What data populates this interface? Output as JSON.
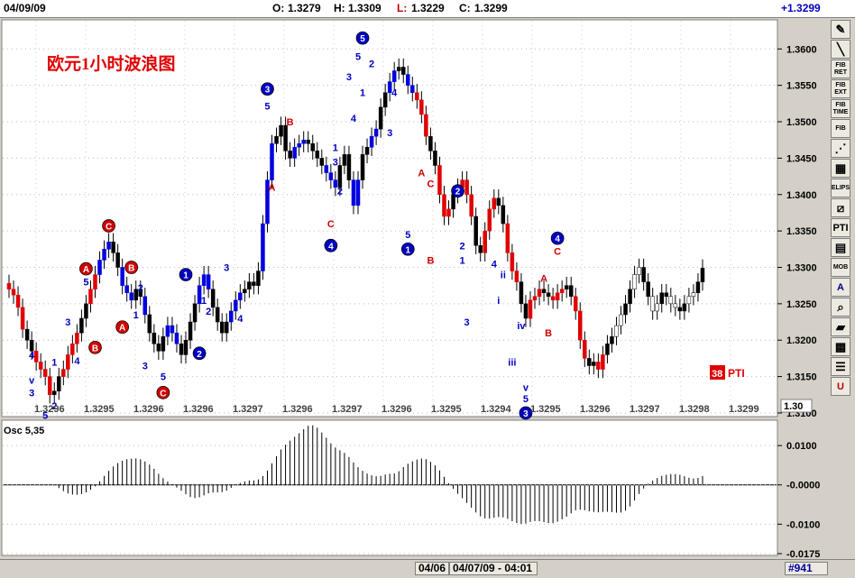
{
  "header": {
    "date": "04/09/09",
    "open_label": "O:",
    "open_value": "1.3279",
    "high_label": "H:",
    "high_value": "1.3309",
    "low_label": "L:",
    "low_value": "1.3229",
    "close_label": "C:",
    "close_value": "1.3299",
    "change": "+1.3299"
  },
  "chart_data": {
    "type": "candlestick",
    "title": "欧元1小时波浪图",
    "price_axis_ticks": [
      "1.3600",
      "1.3550",
      "1.3500",
      "1.3450",
      "1.3400",
      "1.3350",
      "1.3300",
      "1.3250",
      "1.3200",
      "1.3150",
      "1.3100"
    ],
    "price_range": [
      1.3095,
      1.364
    ],
    "current_price_label": "1.30",
    "x_labels": [
      "1.3296",
      "1.3295",
      "1.3296",
      "1.3296",
      "1.3297",
      "1.3296",
      "1.3297",
      "1.3296",
      "1.3295",
      "1.3294",
      "1.3295",
      "1.3296",
      "1.3297",
      "1.3298",
      "1.3299"
    ],
    "closes": [
      1.327,
      1.3262,
      1.3245,
      1.3215,
      1.32,
      1.3185,
      1.317,
      1.316,
      1.315,
      1.3125,
      1.313,
      1.315,
      1.316,
      1.318,
      1.3195,
      1.321,
      1.323,
      1.325,
      1.327,
      1.329,
      1.331,
      1.3325,
      1.3335,
      1.332,
      1.33,
      1.3275,
      1.3265,
      1.3255,
      1.327,
      1.326,
      1.3235,
      1.321,
      1.3195,
      1.3185,
      1.3205,
      1.322,
      1.321,
      1.3195,
      1.318,
      1.32,
      1.3225,
      1.325,
      1.3275,
      1.329,
      1.327,
      1.3245,
      1.3225,
      1.321,
      1.3225,
      1.324,
      1.3255,
      1.3265,
      1.327,
      1.328,
      1.3275,
      1.3295,
      1.336,
      1.342,
      1.347,
      1.348,
      1.3495,
      1.346,
      1.345,
      1.3465,
      1.347,
      1.3475,
      1.347,
      1.346,
      1.345,
      1.344,
      1.343,
      1.342,
      1.341,
      1.344,
      1.3455,
      1.342,
      1.3385,
      1.342,
      1.3455,
      1.3465,
      1.348,
      1.349,
      1.352,
      1.354,
      1.3555,
      1.357,
      1.3575,
      1.3565,
      1.355,
      1.354,
      1.353,
      1.351,
      1.348,
      1.346,
      1.344,
      1.34,
      1.337,
      1.338,
      1.34,
      1.341,
      1.342,
      1.34,
      1.337,
      1.333,
      1.332,
      1.335,
      1.338,
      1.3395,
      1.3385,
      1.336,
      1.332,
      1.3295,
      1.328,
      1.325,
      1.323,
      1.3255,
      1.326,
      1.327,
      1.3265,
      1.326,
      1.3255,
      1.3265,
      1.327,
      1.3275,
      1.326,
      1.324,
      1.32,
      1.3175,
      1.3165,
      1.317,
      1.316,
      1.318,
      1.3195,
      1.3205,
      1.322,
      1.3235,
      1.325,
      1.327,
      1.329,
      1.33,
      1.328,
      1.326,
      1.324,
      1.325,
      1.3265,
      1.326,
      1.325,
      1.3245,
      1.324,
      1.325,
      1.326,
      1.3265,
      1.328,
      1.3299
    ],
    "wave_labels": [
      {
        "text": "4",
        "price": 1.318,
        "bar": 5,
        "color": "blue",
        "style": "plain"
      },
      {
        "text": "v",
        "price": 1.3145,
        "bar": 5,
        "color": "blue",
        "style": "plain"
      },
      {
        "text": "3",
        "price": 1.3128,
        "bar": 5,
        "color": "blue",
        "style": "plain"
      },
      {
        "text": "5",
        "price": 1.3097,
        "bar": 8,
        "color": "blue",
        "style": "plain"
      },
      {
        "text": "2",
        "price": 1.311,
        "bar": 10,
        "color": "blue",
        "style": "plain"
      },
      {
        "text": "1",
        "price": 1.317,
        "bar": 10,
        "color": "blue",
        "style": "plain"
      },
      {
        "text": "3",
        "price": 1.3225,
        "bar": 13,
        "color": "blue",
        "style": "plain"
      },
      {
        "text": "4",
        "price": 1.3172,
        "bar": 15,
        "color": "blue",
        "style": "plain"
      },
      {
        "text": "A",
        "price": 1.3298,
        "bar": 17,
        "color": "red",
        "style": "circle"
      },
      {
        "text": "5",
        "price": 1.328,
        "bar": 17,
        "color": "blue",
        "style": "plain"
      },
      {
        "text": "B",
        "price": 1.319,
        "bar": 19,
        "color": "red",
        "style": "circle"
      },
      {
        "text": "C",
        "price": 1.3357,
        "bar": 22,
        "color": "red",
        "style": "circle"
      },
      {
        "text": "A",
        "price": 1.3218,
        "bar": 25,
        "color": "red",
        "style": "circle"
      },
      {
        "text": "B",
        "price": 1.33,
        "bar": 27,
        "color": "red",
        "style": "circle"
      },
      {
        "text": "2",
        "price": 1.3272,
        "bar": 29,
        "color": "blue",
        "style": "plain"
      },
      {
        "text": "1",
        "price": 1.3235,
        "bar": 28,
        "color": "blue",
        "style": "plain"
      },
      {
        "text": "3",
        "price": 1.3165,
        "bar": 30,
        "color": "blue",
        "style": "plain"
      },
      {
        "text": "5",
        "price": 1.315,
        "bar": 34,
        "color": "blue",
        "style": "plain"
      },
      {
        "text": "C",
        "price": 1.3128,
        "bar": 34,
        "color": "red",
        "style": "circle"
      },
      {
        "text": "1",
        "price": 1.329,
        "bar": 39,
        "color": "blue",
        "style": "filled"
      },
      {
        "text": "1",
        "price": 1.3255,
        "bar": 43,
        "color": "blue",
        "style": "plain"
      },
      {
        "text": "2",
        "price": 1.324,
        "bar": 44,
        "color": "blue",
        "style": "plain"
      },
      {
        "text": "2",
        "price": 1.3182,
        "bar": 42,
        "color": "blue",
        "style": "filled"
      },
      {
        "text": "3",
        "price": 1.33,
        "bar": 48,
        "color": "blue",
        "style": "plain"
      },
      {
        "text": "4",
        "price": 1.323,
        "bar": 51,
        "color": "blue",
        "style": "plain"
      },
      {
        "text": "3",
        "price": 1.3545,
        "bar": 57,
        "color": "blue",
        "style": "filled"
      },
      {
        "text": "5",
        "price": 1.3522,
        "bar": 57,
        "color": "blue",
        "style": "plain"
      },
      {
        "text": "A",
        "price": 1.341,
        "bar": 58,
        "color": "red",
        "style": "plain"
      },
      {
        "text": "B",
        "price": 1.35,
        "bar": 62,
        "color": "red",
        "style": "plain"
      },
      {
        "text": "1",
        "price": 1.3465,
        "bar": 72,
        "color": "blue",
        "style": "plain"
      },
      {
        "text": "3",
        "price": 1.3445,
        "bar": 72,
        "color": "blue",
        "style": "plain"
      },
      {
        "text": "2",
        "price": 1.3405,
        "bar": 73,
        "color": "blue",
        "style": "plain"
      },
      {
        "text": "C",
        "price": 1.336,
        "bar": 71,
        "color": "red",
        "style": "plain"
      },
      {
        "text": "4",
        "price": 1.333,
        "bar": 71,
        "color": "blue",
        "style": "filled"
      },
      {
        "text": "5",
        "price": 1.3615,
        "bar": 78,
        "color": "blue",
        "style": "filled"
      },
      {
        "text": "5",
        "price": 1.359,
        "bar": 77,
        "color": "blue",
        "style": "plain"
      },
      {
        "text": "2",
        "price": 1.358,
        "bar": 80,
        "color": "blue",
        "style": "plain"
      },
      {
        "text": "3",
        "price": 1.3562,
        "bar": 75,
        "color": "blue",
        "style": "plain"
      },
      {
        "text": "1",
        "price": 1.354,
        "bar": 78,
        "color": "blue",
        "style": "plain"
      },
      {
        "text": "4",
        "price": 1.3505,
        "bar": 76,
        "color": "blue",
        "style": "plain"
      },
      {
        "text": "4",
        "price": 1.354,
        "bar": 85,
        "color": "blue",
        "style": "plain"
      },
      {
        "text": "3",
        "price": 1.3485,
        "bar": 84,
        "color": "blue",
        "style": "plain"
      },
      {
        "text": "A",
        "price": 1.343,
        "bar": 91,
        "color": "red",
        "style": "plain"
      },
      {
        "text": "C",
        "price": 1.3415,
        "bar": 93,
        "color": "red",
        "style": "plain"
      },
      {
        "text": "5",
        "price": 1.3345,
        "bar": 88,
        "color": "blue",
        "style": "plain"
      },
      {
        "text": "1",
        "price": 1.3325,
        "bar": 88,
        "color": "blue",
        "style": "filled"
      },
      {
        "text": "B",
        "price": 1.331,
        "bar": 93,
        "color": "red",
        "style": "plain"
      },
      {
        "text": "2",
        "price": 1.3405,
        "bar": 99,
        "color": "blue",
        "style": "filled"
      },
      {
        "text": "2",
        "price": 1.333,
        "bar": 100,
        "color": "blue",
        "style": "plain"
      },
      {
        "text": "1",
        "price": 1.331,
        "bar": 100,
        "color": "blue",
        "style": "plain"
      },
      {
        "text": "3",
        "price": 1.3225,
        "bar": 101,
        "color": "blue",
        "style": "plain"
      },
      {
        "text": "4",
        "price": 1.3305,
        "bar": 107,
        "color": "blue",
        "style": "plain"
      },
      {
        "text": "ii",
        "price": 1.329,
        "bar": 109,
        "color": "blue",
        "style": "plain"
      },
      {
        "text": "i",
        "price": 1.3255,
        "bar": 108,
        "color": "blue",
        "style": "plain"
      },
      {
        "text": "iv",
        "price": 1.322,
        "bar": 113,
        "color": "blue",
        "style": "plain"
      },
      {
        "text": "iii",
        "price": 1.317,
        "bar": 111,
        "color": "blue",
        "style": "plain"
      },
      {
        "text": "v",
        "price": 1.3135,
        "bar": 114,
        "color": "blue",
        "style": "plain"
      },
      {
        "text": "5",
        "price": 1.312,
        "bar": 114,
        "color": "blue",
        "style": "plain"
      },
      {
        "text": "3",
        "price": 1.31,
        "bar": 114,
        "color": "blue",
        "style": "filled"
      },
      {
        "text": "A",
        "price": 1.3285,
        "bar": 118,
        "color": "red",
        "style": "plain"
      },
      {
        "text": "B",
        "price": 1.321,
        "bar": 119,
        "color": "red",
        "style": "plain"
      },
      {
        "text": "4",
        "price": 1.334,
        "bar": 121,
        "color": "blue",
        "style": "filled"
      },
      {
        "text": "C",
        "price": 1.3322,
        "bar": 121,
        "color": "red",
        "style": "plain"
      }
    ],
    "oscillator": {
      "label": "Osc 5,35",
      "ticks": [
        "0.0100",
        "-0.0000",
        "-0.0100",
        "-0.0175"
      ]
    },
    "pti_value": "38",
    "pti_label": "PTI"
  },
  "toolbar": {
    "buttons": [
      {
        "name": "pencil-tool-button",
        "icon": "pencil-icon",
        "label": ""
      },
      {
        "name": "eraser-tool-button",
        "icon": "line-icon",
        "label": ""
      },
      {
        "name": "fib-ret-button",
        "icon": "",
        "label": "FIB RET"
      },
      {
        "name": "fib-ext-button",
        "icon": "",
        "label": "FIB EXT"
      },
      {
        "name": "fib-time-button",
        "icon": "",
        "label": "FIB TIME"
      },
      {
        "name": "fib-arc-button",
        "icon": "",
        "label": "FIB"
      },
      {
        "name": "fan-button",
        "icon": "fan-icon",
        "label": ""
      },
      {
        "name": "grid-button",
        "icon": "grid-icon",
        "label": ""
      },
      {
        "name": "elips-button",
        "icon": "",
        "label": "ELIPS"
      },
      {
        "name": "channel-button",
        "icon": "channel-icon",
        "label": ""
      },
      {
        "name": "pti-button",
        "icon": "",
        "label": "PTI"
      },
      {
        "name": "table-button",
        "icon": "table-icon",
        "label": ""
      },
      {
        "name": "mob-button",
        "icon": "",
        "label": "MOB"
      },
      {
        "name": "text-button",
        "icon": "",
        "label": "A"
      },
      {
        "name": "zoom-button",
        "icon": "magnifier-icon",
        "label": ""
      },
      {
        "name": "delete-button",
        "icon": "eraser-icon",
        "label": ""
      },
      {
        "name": "pattern-button",
        "icon": "pattern-icon",
        "label": ""
      },
      {
        "name": "properties-button",
        "icon": "list-icon",
        "label": ""
      },
      {
        "name": "u-button",
        "icon": "",
        "label": "U"
      }
    ]
  },
  "footer": {
    "date_left": "04/06",
    "date_right": "04/07/09 - 04:01",
    "bar_number": "#941"
  }
}
